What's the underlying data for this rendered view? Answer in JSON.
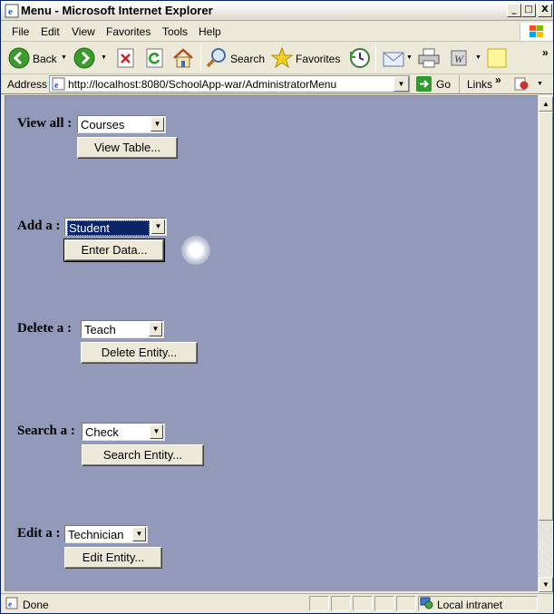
{
  "window": {
    "title": "Menu - Microsoft Internet Explorer",
    "controls": {
      "minimize": "_",
      "maximize": "□",
      "close": "X"
    }
  },
  "menubar": {
    "items": [
      "File",
      "Edit",
      "View",
      "Favorites",
      "Tools",
      "Help"
    ]
  },
  "toolbar": {
    "back_label": "Back",
    "search_label": "Search",
    "favorites_label": "Favorites",
    "overflow": "»"
  },
  "addressbar": {
    "label": "Address",
    "url": "http://localhost:8080/SchoolApp-war/AdministratorMenu",
    "go_label": "Go",
    "links_label": "Links",
    "links_overflow": "»"
  },
  "form": {
    "view": {
      "label": "View all :",
      "selected": "Courses",
      "button": "View Table..."
    },
    "add": {
      "label": "Add a :",
      "selected": "Student",
      "button": "Enter Data..."
    },
    "delete": {
      "label": "Delete a :",
      "selected": "Teach",
      "button": "Delete Entity..."
    },
    "search": {
      "label": "Search a :",
      "selected": "Check",
      "button": "Search Entity..."
    },
    "edit": {
      "label": "Edit a :",
      "selected": "Technician",
      "button": "Edit Entity..."
    }
  },
  "statusbar": {
    "status": "Done",
    "zone": "Local intranet"
  },
  "colors": {
    "page_background": "#9299b9",
    "title_gradient_end": "#dcdad0",
    "focus_highlight": "#0a246a"
  },
  "icons": [
    "ie-icon",
    "windows-flag-icon",
    "back-arrow-icon",
    "forward-arrow-icon",
    "stop-icon",
    "refresh-icon",
    "home-icon",
    "search-magnifier-icon",
    "favorites-star-icon",
    "history-icon",
    "mail-icon",
    "print-icon",
    "edit-icon",
    "messenger-icon",
    "go-arrow-icon",
    "links-page-icon",
    "done-page-icon",
    "intranet-zone-icon"
  ]
}
